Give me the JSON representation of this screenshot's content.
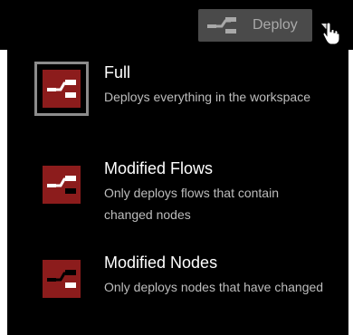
{
  "deploy": {
    "label": "Deploy",
    "icon": "deploy-icon"
  },
  "colors": {
    "icon_red": "#8c1c1c",
    "menu_bg": "#000000",
    "button_bg": "#4a4a4a"
  },
  "menu": {
    "items": [
      {
        "title": "Full",
        "description": "Deploys everything in the workspace",
        "selected": true
      },
      {
        "title": "Modified Flows",
        "description": "Only deploys flows that contain changed nodes",
        "selected": false
      },
      {
        "title": "Modified Nodes",
        "description": "Only deploys nodes that have changed",
        "selected": false
      }
    ]
  }
}
